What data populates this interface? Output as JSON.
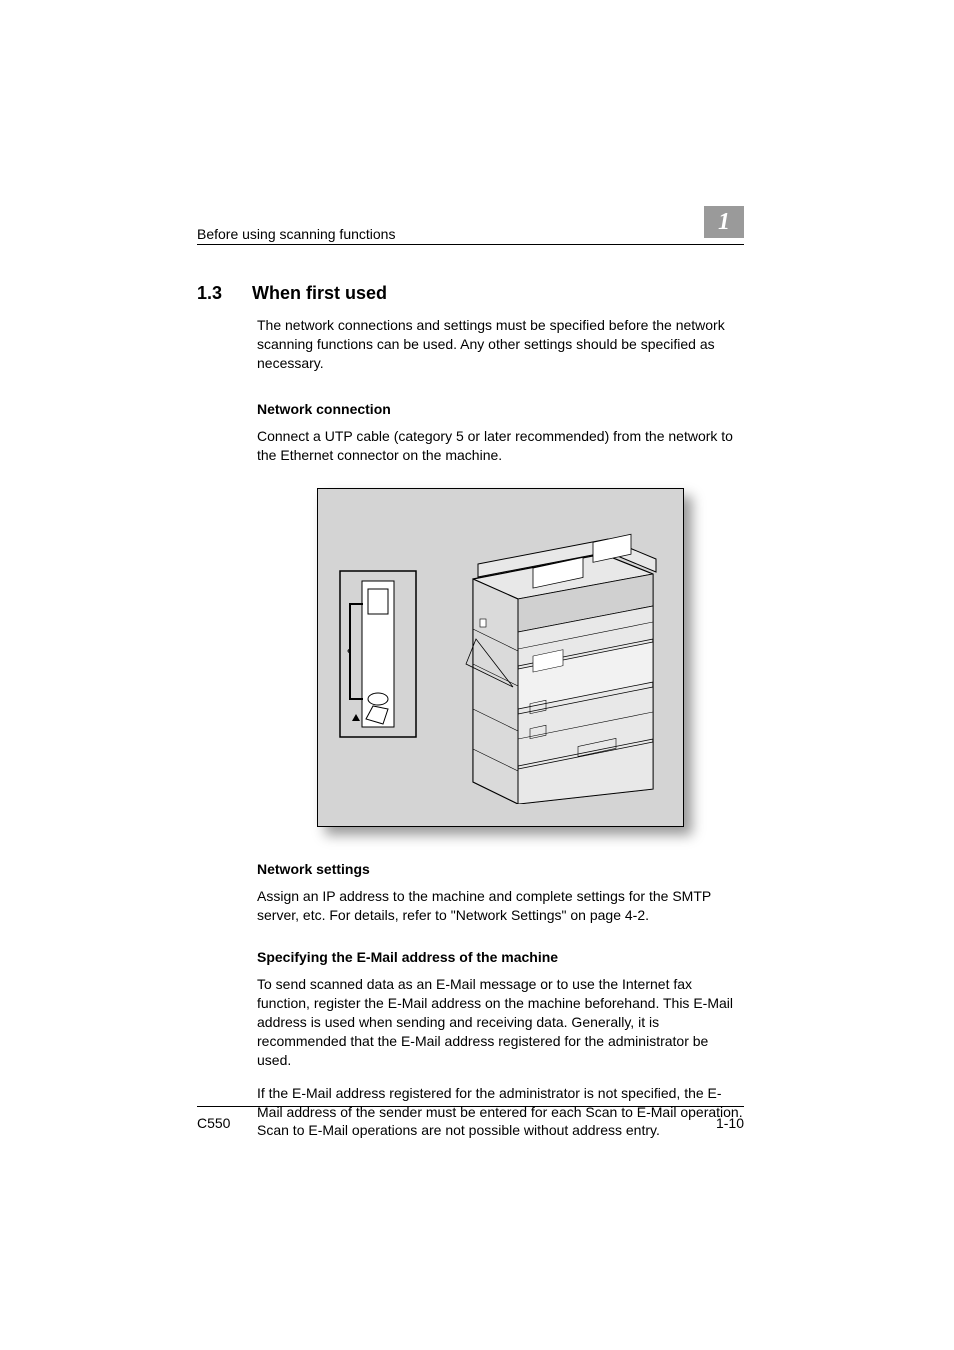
{
  "header": {
    "breadcrumb": "Before using scanning functions",
    "chapter": "1"
  },
  "section": {
    "number": "1.3",
    "title": "When first used",
    "intro": "The network connections and settings must be specified before the network scanning functions can be used. Any other settings should be specified as necessary."
  },
  "sub1": {
    "heading": "Network connection",
    "para": "Connect a UTP cable (category 5 or later recommended) from the network to the Ethernet connector on the machine."
  },
  "sub2": {
    "heading": "Network settings",
    "para": "Assign an IP address to the machine and complete settings for the SMTP server, etc. For details, refer to \"Network Settings\" on page 4-2."
  },
  "sub3": {
    "heading": "Specifying the E-Mail address of the machine",
    "para1": "To send scanned data as an E-Mail message or to use the Internet fax function, register the E-Mail address on the machine beforehand. This E-Mail address is used when sending and receiving data. Generally, it is recommended that the E-Mail address registered for the administrator be used.",
    "para2": "If the E-Mail address registered for the administrator is not specified, the E-Mail address of the sender must be entered for each Scan to E-Mail operation. Scan to E-Mail operations are not possible without address entry."
  },
  "footer": {
    "model": "C550",
    "page": "1-10"
  }
}
